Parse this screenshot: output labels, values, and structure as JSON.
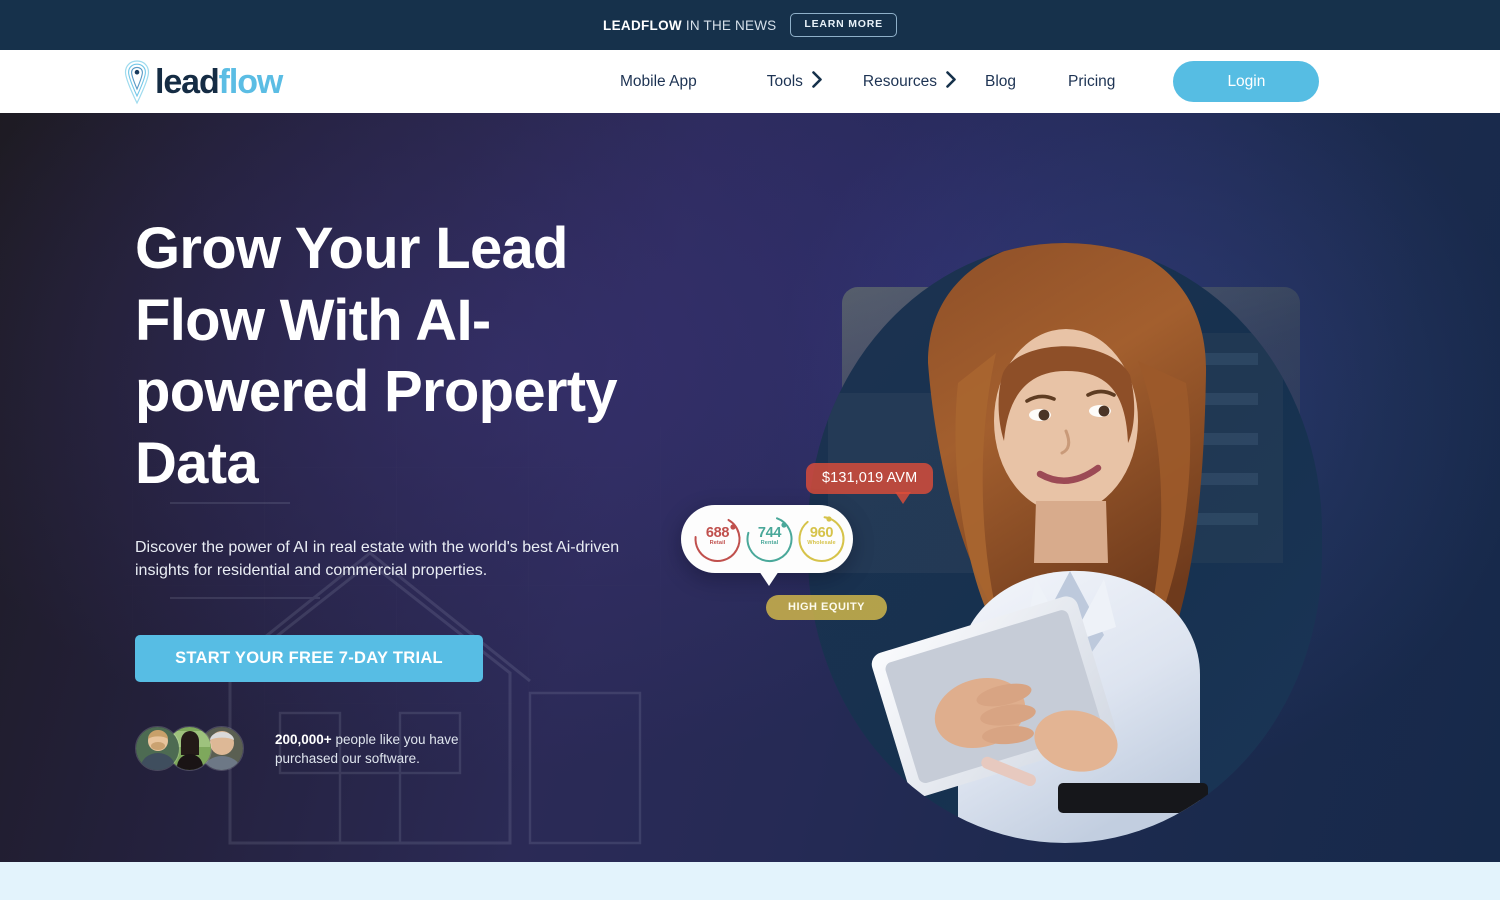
{
  "announcement": {
    "brand": "LEADFLOW",
    "text": " IN THE NEWS",
    "button_label": "LEARN MORE"
  },
  "nav": {
    "logo": {
      "dark_part": "lead",
      "light_part": "flow",
      "icon": "location-pin-signal-icon"
    },
    "items": [
      {
        "label": "Mobile App",
        "has_chevron": false
      },
      {
        "label": "Tools",
        "has_chevron": true
      },
      {
        "label": "Resources",
        "has_chevron": true
      },
      {
        "label": "Blog",
        "has_chevron": false
      },
      {
        "label": "Pricing",
        "has_chevron": false
      }
    ],
    "login_label": "Login"
  },
  "hero": {
    "title": "Grow Your Lead Flow With AI-powered Property Data",
    "subtitle": "Discover the power of AI in real estate with the world's best Ai-driven insights for residential and commercial properties.",
    "cta_label": "START YOUR FREE 7-DAY TRIAL",
    "proof": {
      "count": "200,000+",
      "text": " people like you have purchased our software."
    },
    "badges": {
      "avm": "$131,019 AVM",
      "equity": "HIGH EQUITY"
    },
    "metrics": [
      {
        "value": "688",
        "label": "Retail",
        "color": "#c0504d",
        "pct": 68
      },
      {
        "value": "744",
        "label": "Rental",
        "color": "#4aa89a",
        "pct": 74
      },
      {
        "value": "960",
        "label": "Wholesale",
        "color": "#d6c34a",
        "pct": 88
      }
    ]
  },
  "colors": {
    "accent_blue": "#56bde3",
    "navy": "#16314b",
    "announce_bg": "#16314b",
    "page_bg": "#e3f3fc"
  }
}
